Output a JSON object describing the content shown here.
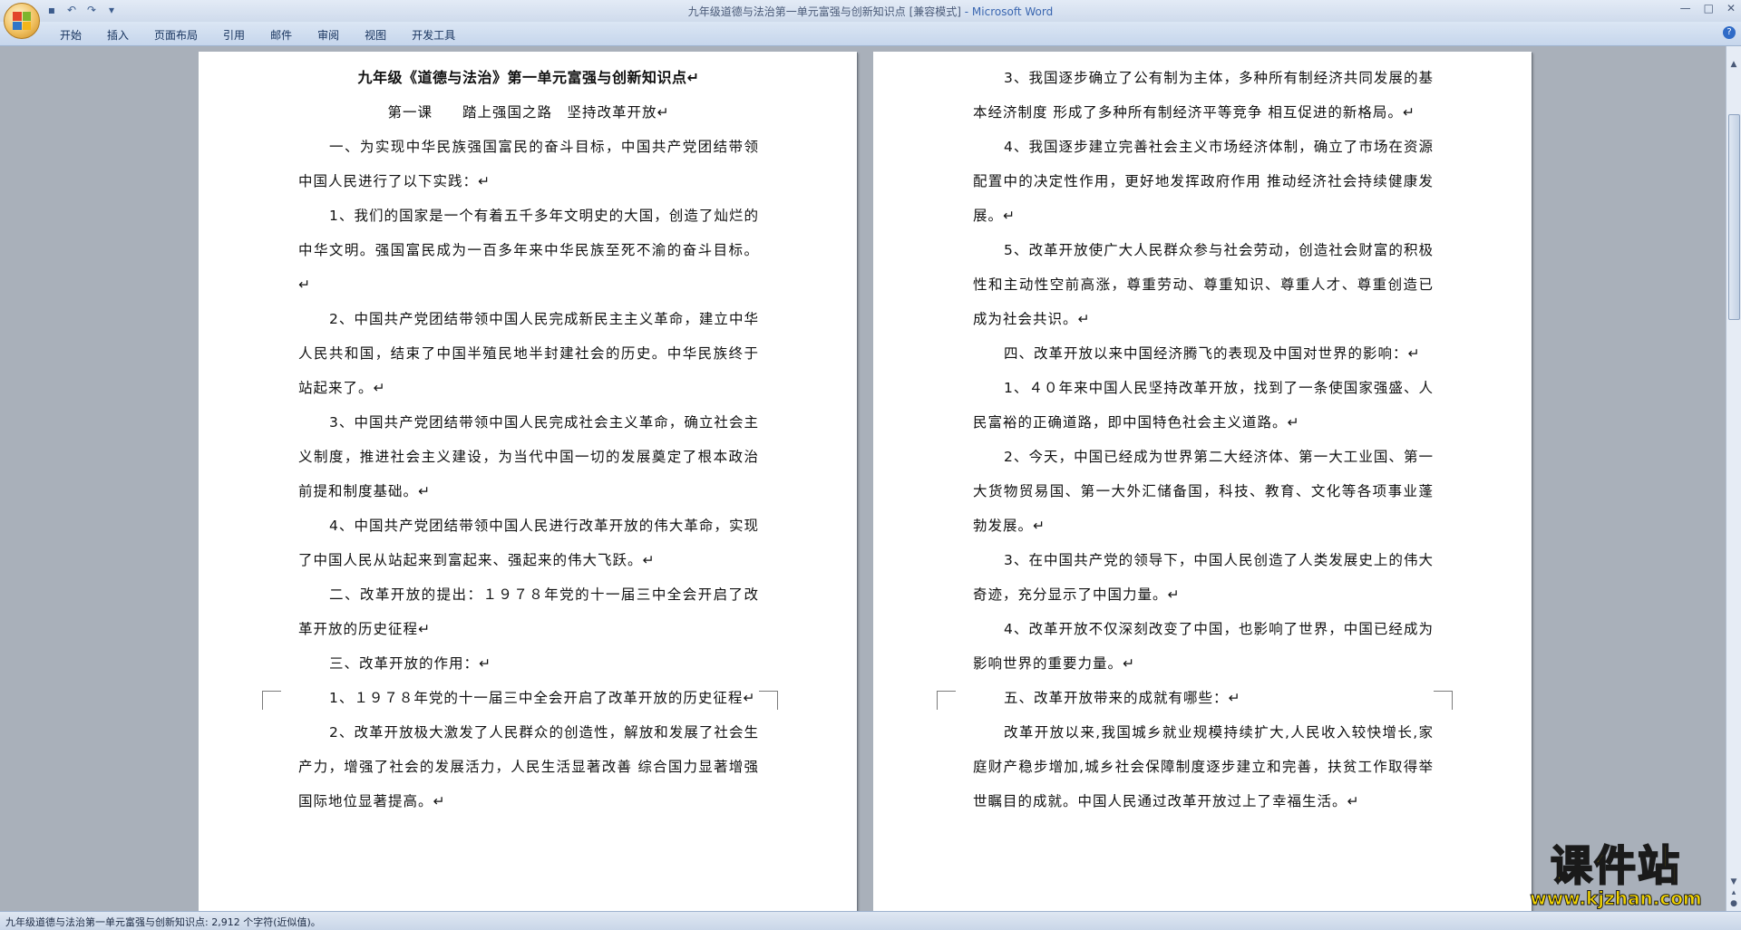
{
  "window": {
    "title": "九年级道德与法治第一单元富强与创新知识点 [兼容模式]",
    "app": " - Microsoft Word",
    "controls": [
      "—",
      "□",
      "✕"
    ]
  },
  "ribbon": {
    "tabs": [
      "开始",
      "插入",
      "页面布局",
      "引用",
      "邮件",
      "审阅",
      "视图",
      "开发工具"
    ]
  },
  "page1": {
    "title": "九年级《道德与法治》第一单元富强与创新知识点",
    "subtitle": "第一课　　踏上强国之路　坚持改革开放",
    "paragraphs": [
      "一、为实现中华民族强国富民的奋斗目标，中国共产党团结带领中国人民进行了以下实践：",
      "1、我们的国家是一个有着五千多年文明史的大国，创造了灿烂的中华文明。强国富民成为一百多年来中华民族至死不渝的奋斗目标。",
      "2、中国共产党团结带领中国人民完成新民主主义革命，建立中华人民共和国，结束了中国半殖民地半封建社会的历史。中华民族终于站起来了。",
      "3、中国共产党团结带领中国人民完成社会主义革命，确立社会主义制度，推进社会主义建设，为当代中国一切的发展奠定了根本政治前提和制度基础。",
      "4、中国共产党团结带领中国人民进行改革开放的伟大革命，实现了中国人民从站起来到富起来、强起来的伟大飞跃。",
      "二、改革开放的提出：１９７８年党的十一届三中全会开启了改革开放的历史征程",
      "三、改革开放的作用：",
      "1、１９７８年党的十一届三中全会开启了改革开放的历史征程",
      "2、改革开放极大激发了人民群众的创造性，解放和发展了社会生产力，增强了社会的发展活力，人民生活显著改善 综合国力显著增强 国际地位显著提高。"
    ]
  },
  "page2": {
    "paragraphs": [
      "3、我国逐步确立了公有制为主体，多种所有制经济共同发展的基本经济制度 形成了多种所有制经济平等竞争 相互促进的新格局。",
      "4、我国逐步建立完善社会主义市场经济体制，确立了市场在资源配置中的决定性作用，更好地发挥政府作用 推动经济社会持续健康发展。",
      "5、改革开放使广大人民群众参与社会劳动，创造社会财富的积极性和主动性空前高涨，尊重劳动、尊重知识、尊重人才、尊重创造已成为社会共识。",
      "四、改革开放以来中国经济腾飞的表现及中国对世界的影响：",
      "1、４０年来中国人民坚持改革开放，找到了一条使国家强盛、人民富裕的正确道路，即中国特色社会主义道路。",
      "2、今天，中国已经成为世界第二大经济体、第一大工业国、第一大货物贸易国、第一大外汇储备国，科技、教育、文化等各项事业蓬勃发展。",
      "3、在中国共产党的领导下，中国人民创造了人类发展史上的伟大奇迹，充分显示了中国力量。",
      "4、改革开放不仅深刻改变了中国，也影响了世界，中国已经成为影响世界的重要力量。",
      "五、改革开放带来的成就有哪些：",
      "改革开放以来,我国城乡就业规模持续扩大,人民收入较快增长,家庭财产稳步增加,城乡社会保障制度逐步建立和完善，扶贫工作取得举世瞩目的成就。中国人民通过改革开放过上了幸福生活。"
    ]
  },
  "paragraph_mark": "↵",
  "status": {
    "text": "九年级道德与法治第一单元富强与创新知识点: 2,912 个字符(近似值)。"
  },
  "watermark": {
    "title": "课件站",
    "url": "www.kjzhan.com"
  }
}
